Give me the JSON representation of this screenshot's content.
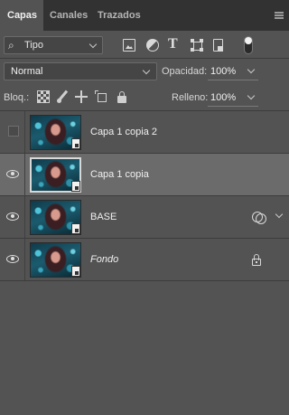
{
  "tabs": [
    {
      "label": "Capas",
      "active": true
    },
    {
      "label": "Canales",
      "active": false
    },
    {
      "label": "Trazados",
      "active": false
    }
  ],
  "filter": {
    "kind_label": "Tipo",
    "icons": [
      "image-filter-icon",
      "adjustment-filter-icon",
      "type-filter-icon",
      "shape-filter-icon",
      "smart-object-filter-icon"
    ]
  },
  "blend": {
    "mode": "Normal",
    "opacity_label": "Opacidad:",
    "opacity_value": "100%"
  },
  "lock": {
    "label": "Bloq.:",
    "fill_label": "Relleno:",
    "fill_value": "100%"
  },
  "layers": [
    {
      "name": "Capa 1 copia 2",
      "visible": false,
      "selected": false,
      "smart_object": true,
      "italic": false
    },
    {
      "name": "Capa 1 copia",
      "visible": true,
      "selected": true,
      "smart_object": true,
      "italic": false
    },
    {
      "name": "BASE",
      "visible": true,
      "selected": false,
      "smart_object": true,
      "italic": false,
      "has_effects": true
    },
    {
      "name": "Fondo",
      "visible": true,
      "selected": false,
      "smart_object": true,
      "italic": true,
      "locked": true
    }
  ],
  "colors": {
    "panel_bg": "#535353",
    "tabbar_bg": "#323232",
    "selected_row": "#6b6b6b"
  }
}
